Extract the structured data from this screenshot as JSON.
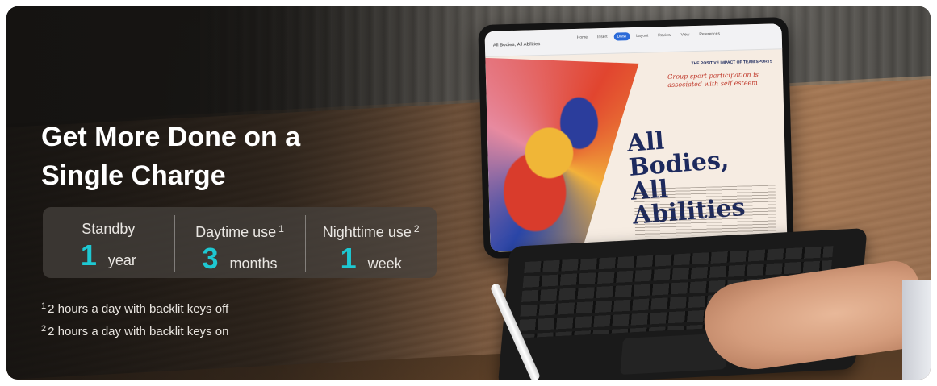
{
  "headline": {
    "line1": "Get More Done on a",
    "line2": "Single Charge"
  },
  "stats": [
    {
      "label": "Standby",
      "note": "",
      "value": "1",
      "unit": "year"
    },
    {
      "label": "Daytime use",
      "note": "1",
      "value": "3",
      "unit": "months"
    },
    {
      "label": "Nighttime use",
      "note": "2",
      "value": "1",
      "unit": "week"
    }
  ],
  "footnotes": [
    {
      "mark": "1",
      "text": "2 hours a day with backlit keys off"
    },
    {
      "mark": "2",
      "text": "2 hours a day with backlit keys on"
    }
  ],
  "tablet_screen": {
    "doc_title": "All Bodies, All Abilities",
    "tabs": [
      "Home",
      "Insert",
      "Draw",
      "Layout",
      "Review",
      "View",
      "References"
    ],
    "active_tab": "Draw",
    "article_heading": "THE POSITIVE IMPACT OF TEAM SPORTS",
    "handwritten_note": "Group sport participation is associated with self esteem",
    "article_title": "All Bodies, All Abilities"
  },
  "colors": {
    "accent": "#1ec8d2",
    "text": "#ffffff",
    "panel": "#46423e"
  }
}
